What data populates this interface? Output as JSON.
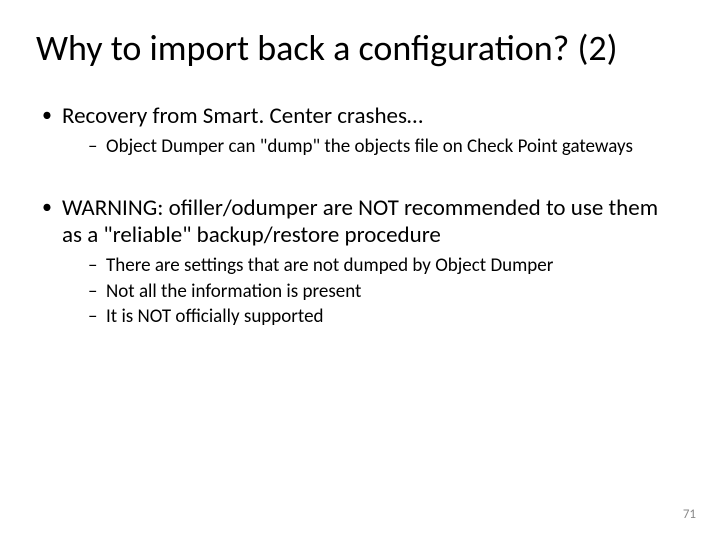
{
  "title": "Why to import back a configuration? (2)",
  "bullets": [
    {
      "text": "Recovery from Smart. Center crashes…",
      "sub": [
        "Object Dumper can \"dump\" the objects file on Check Point gateways"
      ]
    },
    {
      "text": "WARNING: ofiller/odumper are NOT recommended to use them as a \"reliable\" backup/restore procedure",
      "sub": [
        "There are settings that are not dumped by Object Dumper",
        "Not all the information is present",
        "It is NOT officially supported"
      ]
    }
  ],
  "page_number": "71"
}
